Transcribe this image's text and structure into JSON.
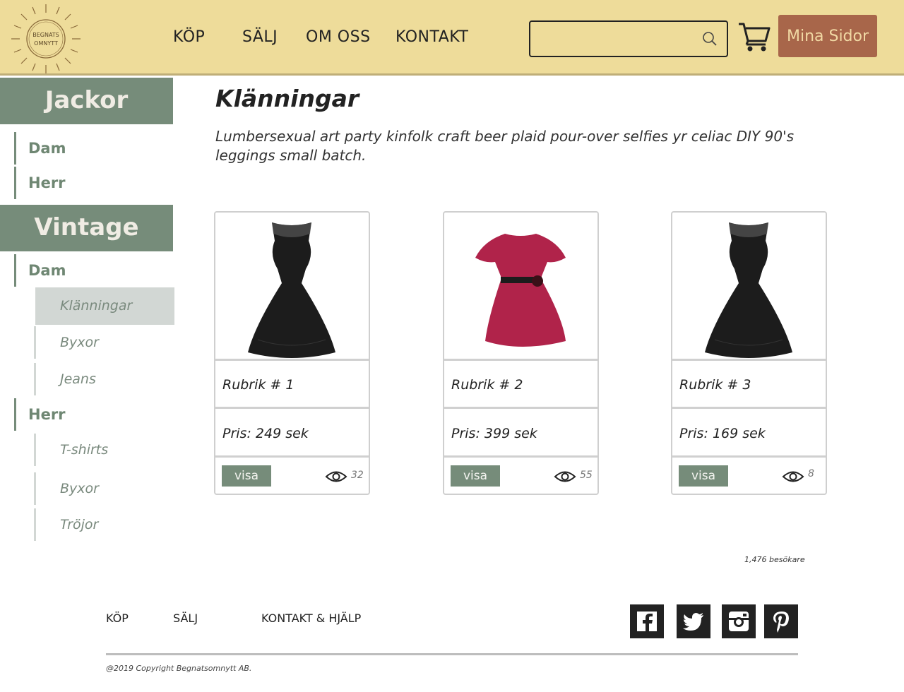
{
  "header": {
    "logo_text_line1": "BEGNATS",
    "logo_text_line2": "OMNYTT",
    "nav": [
      "KÖP",
      "SÄLJ",
      "OM OSS",
      "KONTAKT"
    ],
    "search_placeholder": "",
    "account_button": "Mina Sidor",
    "colors": {
      "background": "#eedc9a",
      "button": "#a8664a"
    }
  },
  "sidebar": {
    "sections": [
      {
        "heading": "Jackor",
        "groups": [
          {
            "label": "Dam",
            "items": []
          },
          {
            "label": "Herr",
            "items": []
          }
        ]
      },
      {
        "heading": "Vintage",
        "groups": [
          {
            "label": "Dam",
            "items": [
              "Klänningar",
              "Byxor",
              "Jeans"
            ]
          },
          {
            "label": "Herr",
            "items": [
              "T-shirts",
              "Byxor",
              "Tröjor"
            ]
          }
        ]
      }
    ],
    "active_item": "Klänningar",
    "colors": {
      "heading": "#768c7a",
      "active": "#d2d7d4"
    }
  },
  "main": {
    "title": "Klänningar",
    "description": "Lumbersexual art party kinfolk craft beer plaid pour-over selfies yr celiac DIY 90's leggings small batch.",
    "products": [
      {
        "title": "Rubrik # 1",
        "price": "Pris: 249 sek",
        "button": "visa",
        "views": "32",
        "image": "black-lace-dress"
      },
      {
        "title": "Rubrik # 2",
        "price": "Pris: 399 sek",
        "button": "visa",
        "views": "55",
        "image": "pink-ruffle-dress"
      },
      {
        "title": "Rubrik # 3",
        "price": "Pris: 169 sek",
        "button": "visa",
        "views": "8",
        "image": "black-lace-dress"
      }
    ],
    "visitors": "1,476 besökare"
  },
  "footer": {
    "links": [
      "KÖP",
      "SÄLJ",
      "KONTAKT & HJÄLP"
    ],
    "social": [
      "facebook-icon",
      "twitter-icon",
      "instagram-icon",
      "pinterest-icon"
    ],
    "copyright": "@2019 Copyright Begnatsomnytt AB."
  }
}
